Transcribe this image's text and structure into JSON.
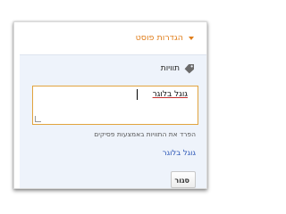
{
  "panel": {
    "title": "הגדרות פוסט",
    "section_label": "תוויות",
    "labels_value": "גוגל בלוגר",
    "helper_text": "הפרד את התוויות באמצעות פסיקים",
    "suggestion": "גוגל בלוגר",
    "close_label": "סגור",
    "accent_color": "#e07e1b",
    "link_color": "#2a55b6"
  }
}
